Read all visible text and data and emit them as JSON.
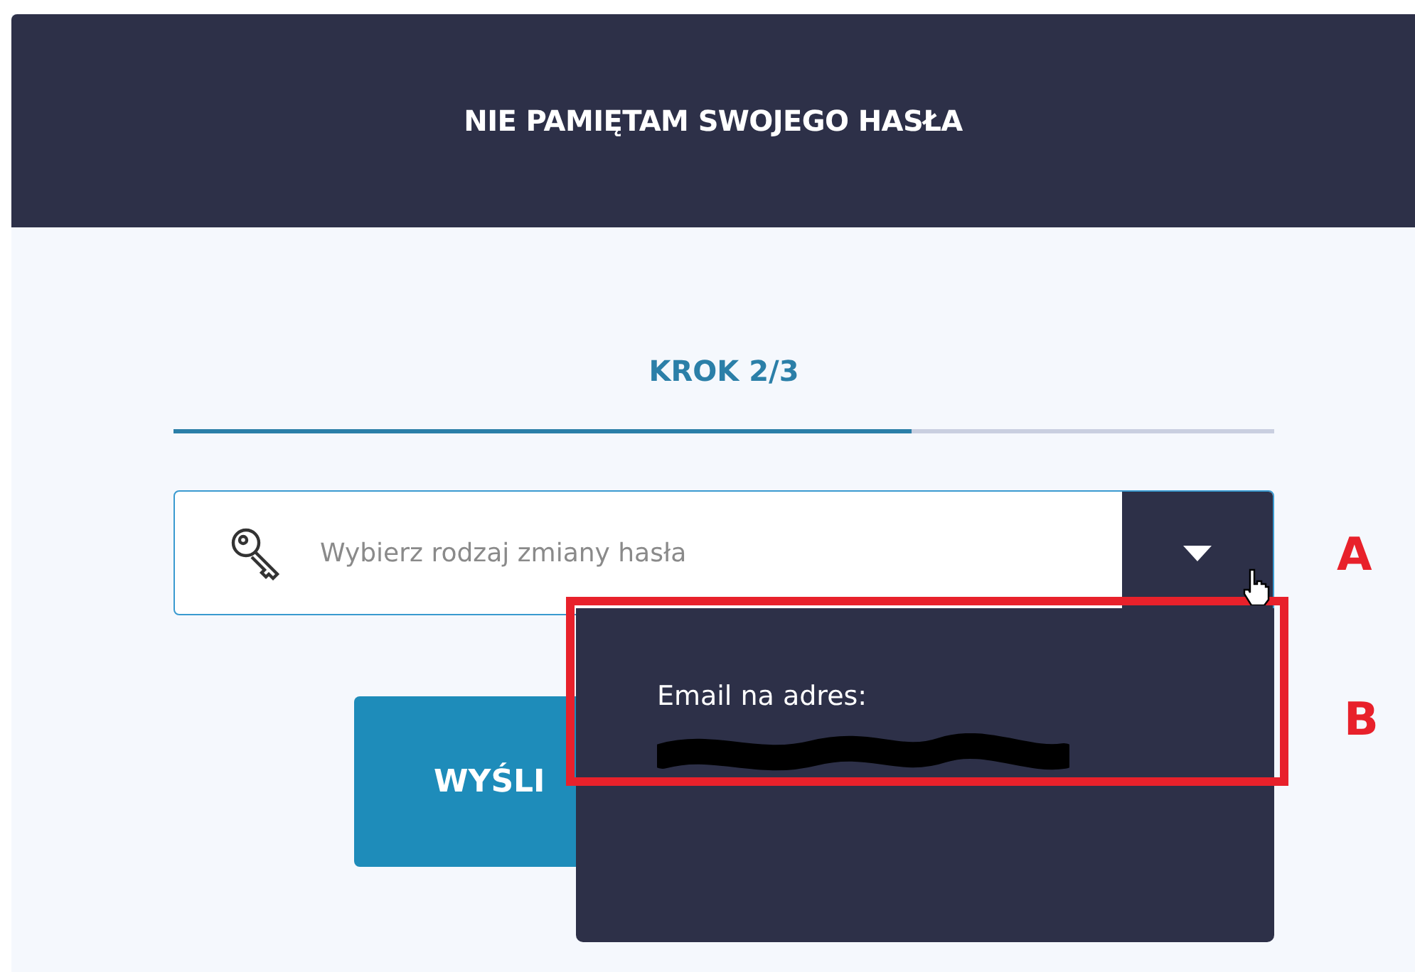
{
  "header": {
    "title": "NIE PAMIĘTAM SWOJEGO HASŁA"
  },
  "step": {
    "label": "KROK 2/3",
    "level": 0.67
  },
  "select": {
    "placeholder": "Wybierz rodzaj zmiany hasła",
    "expanded": true
  },
  "dropdown": {
    "options": [
      {
        "label": "Email na adres:",
        "redacted": true
      }
    ]
  },
  "button": {
    "label": "WYŚLI"
  },
  "annotations": [
    {
      "label": "A",
      "highlight": false
    },
    {
      "label": "B",
      "highlight": true
    }
  ]
}
